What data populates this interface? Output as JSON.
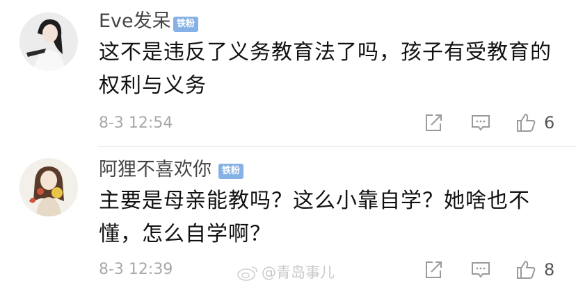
{
  "comments": [
    {
      "username": "Eve发呆",
      "badge": "铁粉",
      "text": "这不是违反了义务教育法了吗，孩子有受教育的权利与义务",
      "time": "8-3 12:54",
      "likes": "6"
    },
    {
      "username": "阿狸不喜欢你",
      "badge": "铁粉",
      "text": "主要是母亲能教吗？这么小靠自学？她啥也不懂，怎么自学啊？",
      "time": "8-3 12:39",
      "likes": "8"
    }
  ],
  "watermark": "@青岛事儿",
  "colors": {
    "badge": "#86b1e6",
    "meta_text": "#a8a8a8",
    "icon_stroke": "#9a9a9a"
  },
  "icons": [
    "share-icon",
    "reply-icon",
    "thumbs-up-icon",
    "weibo-logo-icon"
  ]
}
